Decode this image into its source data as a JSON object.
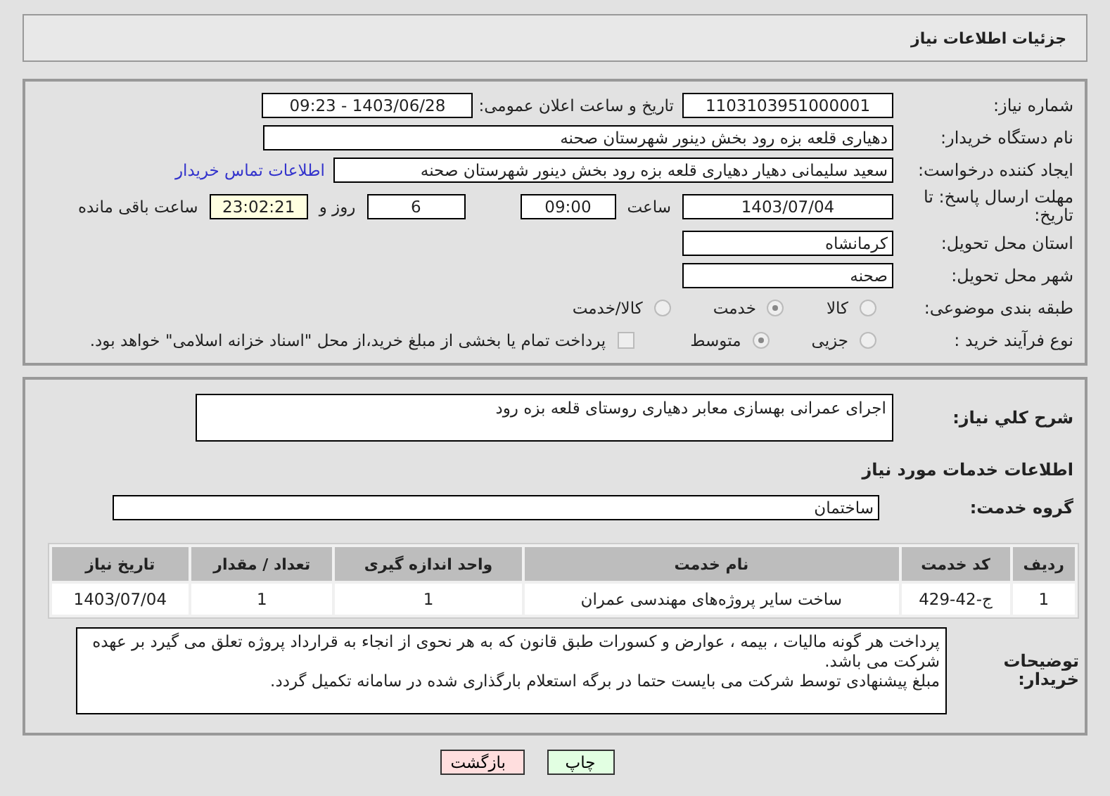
{
  "header": {
    "title": "جزئیات اطلاعات نیاز"
  },
  "need_number": {
    "label": "شماره نیاز:",
    "value": "1103103951000001"
  },
  "announce": {
    "label": "تاریخ و ساعت اعلان عمومی:",
    "value": "1403/06/28 - 09:23"
  },
  "buyer": {
    "label": "نام دستگاه خریدار:",
    "value": "دهیاری قلعه بزه رود بخش دینور شهرستان صحنه"
  },
  "creator": {
    "label": "ایجاد کننده درخواست:",
    "value": "سعید سلیمانی دهیار دهیاری قلعه بزه رود بخش دینور شهرستان صحنه",
    "link": "اطلاعات تماس خریدار"
  },
  "deadline": {
    "label": "مهلت ارسال پاسخ: تا تاریخ:",
    "date": "1403/07/04",
    "time_label": "ساعت",
    "time": "09:00",
    "days": "6",
    "days_label": "روز و",
    "remaining": "23:02:21",
    "remaining_label": "ساعت باقی مانده"
  },
  "province": {
    "label": "استان محل تحویل:",
    "value": "کرمانشاه"
  },
  "city": {
    "label": "شهر محل تحویل:",
    "value": "صحنه"
  },
  "category": {
    "label": "طبقه بندی موضوعی:",
    "options": [
      {
        "label": "کالا",
        "selected": false
      },
      {
        "label": "خدمت",
        "selected": true
      },
      {
        "label": "کالا/خدمت",
        "selected": false
      }
    ]
  },
  "process": {
    "label": "نوع فرآیند خرید :",
    "options": [
      {
        "label": "جزیی",
        "selected": false
      },
      {
        "label": "متوسط",
        "selected": true
      }
    ],
    "payment_checked": false,
    "payment_text": "پرداخت تمام یا بخشی از مبلغ خرید،از محل \"اسناد خزانه اسلامی\" خواهد بود."
  },
  "description": {
    "label": "شرح کلي نياز:",
    "value": "اجرای عمرانی بهسازی معابر دهیاری روستای قلعه بزه رود"
  },
  "services_heading": "اطلاعات خدمات مورد نیاز",
  "service_group": {
    "label": "گروه خدمت:",
    "value": "ساختمان"
  },
  "table": {
    "columns": [
      "ردیف",
      "کد خدمت",
      "نام خدمت",
      "واحد اندازه گیری",
      "تعداد / مقدار",
      "تاریخ نیاز"
    ],
    "rows": [
      [
        "1",
        "ج-42-429",
        "ساخت سایر پروژه‌های مهندسی عمران",
        "1",
        "1",
        "1403/07/04"
      ]
    ]
  },
  "notes": {
    "label": "توضیحات خریدار:",
    "lines": [
      "پرداخت هر گونه مالیات ، بیمه ، عوارض و کسورات طبق قانون که به هر نحوی  از انجاء به قرارداد پروژه تعلق می گیرد بر عهده شرکت می باشد.",
      "مبلغ پیشنهادی  توسط شرکت می بایست حتما در برگه استعلام بارگذاری شده در سامانه تکمیل گردد."
    ]
  },
  "buttons": [
    {
      "label": "چاپ",
      "kind": "print"
    },
    {
      "label": "بازگشت",
      "kind": "back"
    }
  ]
}
